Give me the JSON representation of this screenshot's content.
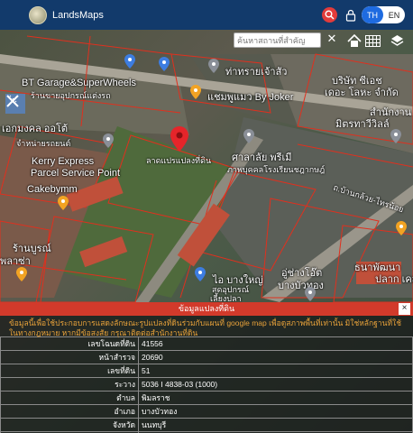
{
  "header": {
    "brand": "LandsMaps",
    "lang_th": "TH",
    "lang_en": "EN"
  },
  "map": {
    "search_placeholder": "ค้นหาสถานที่สำคัญ",
    "labels": [
      "BT Garage&SuperWheels",
      "ร้านขายอุปกรณ์แต่งรถ",
      "ท่าทรายเจ้าสัว",
      "แชมพูแมว By Joker",
      "บริษัท ซีเอช",
      "เดอะ โลหะ จำกัด",
      "สำนักงาน",
      "มิตรทาวีวิลล์",
      "เอกมงคล ออโต้",
      "จำหน่ายรถยนต์",
      "Kerry Express",
      "Parcel Service Point",
      "Cakebymm",
      "ลาดแปรแปลงที่ดิน",
      "ศาลาลัย พรีเมี",
      "ภาพบุคคลโรงเรียนชฎากษฎ์",
      "ถ.บ้านกล้วย-ไทรน้อย",
      "ร้านบูรณ์",
      "พลาซ่า",
      "ไอ บางใหญ่",
      "สุดอุปกรณ์",
      "เลี้ยงปลา",
      "อู่ช่างโอ๊ต",
      "บางบัวทอง",
      "ธนาพัฒนา",
      "ปลาก เคส"
    ]
  },
  "panel": {
    "title": "ข้อมูลแปลงที่ดิน",
    "close": "×",
    "note": "ข้อมูลนี้เพื่อใช้ประกอบการแสดงลักษณะรูปแปลงที่ดินร่วมกับแผนที่ google map เพื่อดูสภาพพื้นที่เท่านั้น มิใช่หลักฐานที่ใช้ในทางกฎหมาย หากมีข้อสงสัย กรุณาติดต่อสำนักงานที่ดิน",
    "rows": [
      {
        "k": "เลขโฉนดที่ดิน",
        "v": "41556"
      },
      {
        "k": "หน้าสำรวจ",
        "v": "20690"
      },
      {
        "k": "เลขที่ดิน",
        "v": "51"
      },
      {
        "k": "ระวาง",
        "v": "5036 I 4838-03 (1000)"
      },
      {
        "k": "ตำบล",
        "v": "พิมลราช"
      },
      {
        "k": "อำเภอ",
        "v": "บางบัวทอง"
      },
      {
        "k": "จังหวัด",
        "v": "นนทบุรี"
      },
      {
        "k": "เนื้อที่",
        "v": "14 ไร่ 3 งาน 83.0 ตารางวา"
      }
    ]
  },
  "colors": {
    "topbar": "#123a6b",
    "accent_red": "#d23a2b",
    "lang_active": "#1e6be0",
    "parcel_line": "#e0301e"
  }
}
